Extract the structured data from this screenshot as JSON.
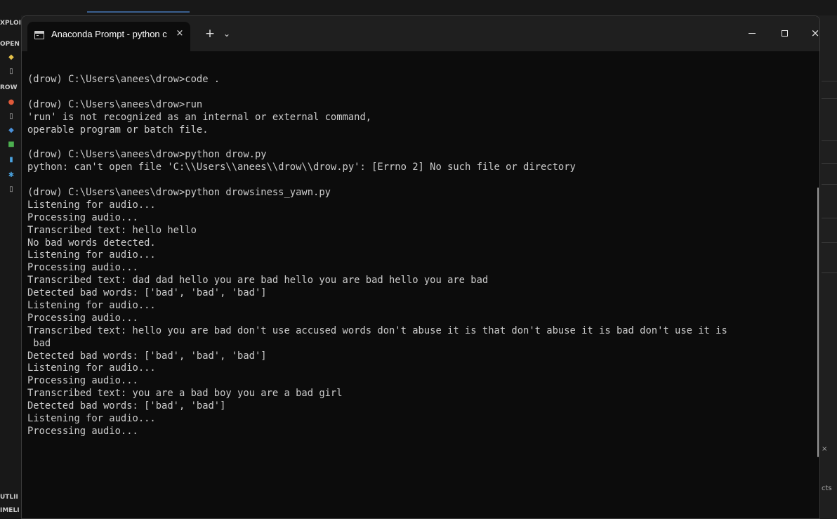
{
  "terminal": {
    "tab_title": "Anaconda Prompt - python c",
    "tab_close": "×",
    "new_tab": "+",
    "dropdown": "⌄",
    "win_close": "×"
  },
  "console_lines": [
    "(drow) C:\\Users\\anees\\drow>code .",
    "",
    "(drow) C:\\Users\\anees\\drow>run",
    "'run' is not recognized as an internal or external command,",
    "operable program or batch file.",
    "",
    "(drow) C:\\Users\\anees\\drow>python drow.py",
    "python: can't open file 'C:\\\\Users\\\\anees\\\\drow\\\\drow.py': [Errno 2] No such file or directory",
    "",
    "(drow) C:\\Users\\anees\\drow>python drowsiness_yawn.py",
    "Listening for audio...",
    "Processing audio...",
    "Transcribed text: hello hello",
    "No bad words detected.",
    "Listening for audio...",
    "Processing audio...",
    "Transcribed text: dad dad hello you are bad hello you are bad hello you are bad",
    "Detected bad words: ['bad', 'bad', 'bad']",
    "Listening for audio...",
    "Processing audio...",
    "Transcribed text: hello you are bad don't use accused words don't abuse it is that don't abuse it is bad don't use it is",
    " bad",
    "Detected bad words: ['bad', 'bad', 'bad']",
    "Listening for audio...",
    "Processing audio...",
    "Transcribed text: you are a bad boy you are a bad girl",
    "Detected bad words: ['bad', 'bad']",
    "Listening for audio...",
    "Processing audio..."
  ],
  "vscode_background": {
    "labels": [
      "XPLOI",
      "OPEN I",
      "ROW",
      "UTLII",
      "IMELI"
    ],
    "right_texts": [
      "×",
      "cts"
    ]
  },
  "colors": {
    "terminal_bg": "#0c0c0c",
    "terminal_text": "#cccccc",
    "titlebar_bg": "#1f1f1f"
  }
}
